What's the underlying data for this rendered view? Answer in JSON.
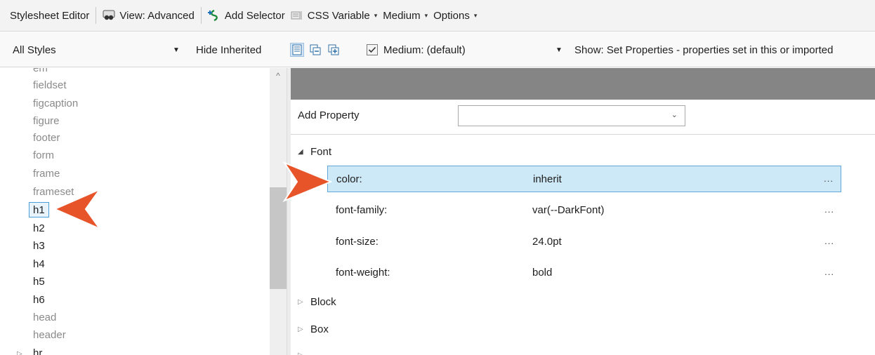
{
  "toolbar": {
    "title": "Stylesheet Editor",
    "view": "View: Advanced",
    "add_selector": "Add Selector",
    "css_variable": "CSS Variable",
    "medium": "Medium",
    "options": "Options"
  },
  "filterbar": {
    "styles_select": "All Styles",
    "hide_inherited": "Hide Inherited",
    "medium_checkbox": "Medium: (default)",
    "show_select": "Show: Set Properties - properties set in this or imported"
  },
  "tree": {
    "items": [
      {
        "label": "fieldset"
      },
      {
        "label": "figcaption"
      },
      {
        "label": "figure"
      },
      {
        "label": "footer"
      },
      {
        "label": "form"
      },
      {
        "label": "frame"
      },
      {
        "label": "frameset"
      },
      {
        "label": "h1"
      },
      {
        "label": "h2"
      },
      {
        "label": "h3"
      },
      {
        "label": "h4"
      },
      {
        "label": "h5"
      },
      {
        "label": "h6"
      },
      {
        "label": "head"
      },
      {
        "label": "header"
      },
      {
        "label": "hr"
      }
    ]
  },
  "properties": {
    "add_property_label": "Add Property",
    "groups": [
      {
        "label": "Font",
        "expanded": true
      },
      {
        "label": "Block",
        "expanded": false
      },
      {
        "label": "Box",
        "expanded": false
      }
    ],
    "rows": [
      {
        "name": "color:",
        "value": "inherit",
        "ellipsis": "..."
      },
      {
        "name": "font-family:",
        "value": "var(--DarkFont)",
        "ellipsis": "..."
      },
      {
        "name": "font-size:",
        "value": "24.0pt",
        "ellipsis": "..."
      },
      {
        "name": "font-weight:",
        "value": "bold",
        "ellipsis": "..."
      }
    ]
  },
  "colors": {
    "callout": "#e8542a",
    "selection_border": "#62a8dc",
    "selection_fill": "#cde8f6",
    "header_strip": "#858585"
  }
}
